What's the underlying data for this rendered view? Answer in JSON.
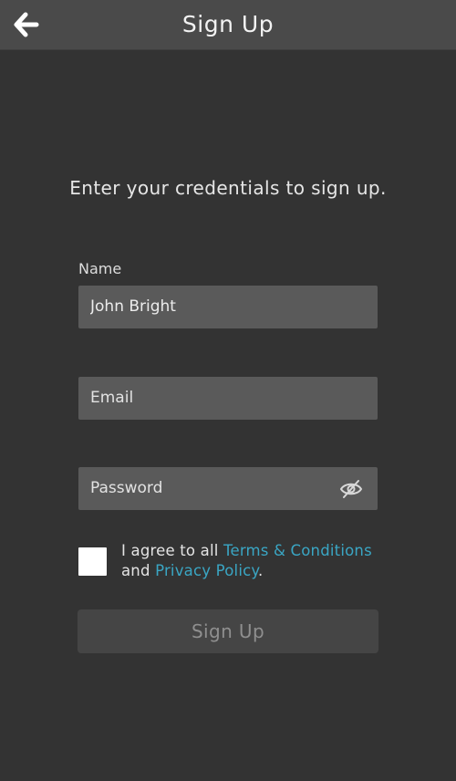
{
  "header": {
    "title": "Sign Up",
    "back_icon": "arrow-left-icon"
  },
  "form": {
    "instruction": "Enter your credentials to sign up.",
    "name": {
      "label": "Name",
      "value": "John Bright"
    },
    "email": {
      "placeholder": "Email",
      "value": ""
    },
    "password": {
      "placeholder": "Password",
      "value": "",
      "toggle_icon": "eye-slash-icon"
    },
    "agreement": {
      "checked": false,
      "text_before": "I agree to all ",
      "terms_link": "Terms & Conditions",
      "text_middle": " and ",
      "privacy_link": "Privacy Policy",
      "text_after": "."
    },
    "submit_label": "Sign Up"
  },
  "colors": {
    "background": "#333333",
    "header": "#4a4a4a",
    "input": "#5a5a5a",
    "link": "#3aa6c4",
    "button": "#454545"
  }
}
